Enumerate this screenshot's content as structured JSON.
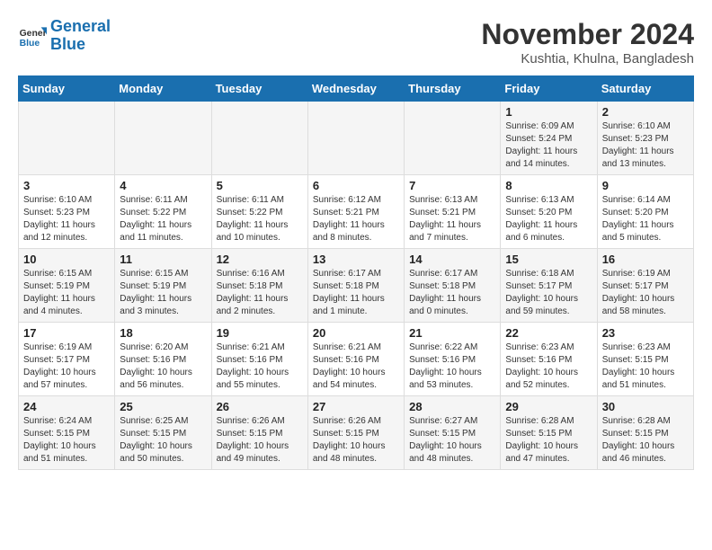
{
  "logo": {
    "line1": "General",
    "line2": "Blue"
  },
  "title": "November 2024",
  "location": "Kushtia, Khulna, Bangladesh",
  "weekdays": [
    "Sunday",
    "Monday",
    "Tuesday",
    "Wednesday",
    "Thursday",
    "Friday",
    "Saturday"
  ],
  "weeks": [
    [
      {
        "day": "",
        "info": ""
      },
      {
        "day": "",
        "info": ""
      },
      {
        "day": "",
        "info": ""
      },
      {
        "day": "",
        "info": ""
      },
      {
        "day": "",
        "info": ""
      },
      {
        "day": "1",
        "info": "Sunrise: 6:09 AM\nSunset: 5:24 PM\nDaylight: 11 hours and 14 minutes."
      },
      {
        "day": "2",
        "info": "Sunrise: 6:10 AM\nSunset: 5:23 PM\nDaylight: 11 hours and 13 minutes."
      }
    ],
    [
      {
        "day": "3",
        "info": "Sunrise: 6:10 AM\nSunset: 5:23 PM\nDaylight: 11 hours and 12 minutes."
      },
      {
        "day": "4",
        "info": "Sunrise: 6:11 AM\nSunset: 5:22 PM\nDaylight: 11 hours and 11 minutes."
      },
      {
        "day": "5",
        "info": "Sunrise: 6:11 AM\nSunset: 5:22 PM\nDaylight: 11 hours and 10 minutes."
      },
      {
        "day": "6",
        "info": "Sunrise: 6:12 AM\nSunset: 5:21 PM\nDaylight: 11 hours and 8 minutes."
      },
      {
        "day": "7",
        "info": "Sunrise: 6:13 AM\nSunset: 5:21 PM\nDaylight: 11 hours and 7 minutes."
      },
      {
        "day": "8",
        "info": "Sunrise: 6:13 AM\nSunset: 5:20 PM\nDaylight: 11 hours and 6 minutes."
      },
      {
        "day": "9",
        "info": "Sunrise: 6:14 AM\nSunset: 5:20 PM\nDaylight: 11 hours and 5 minutes."
      }
    ],
    [
      {
        "day": "10",
        "info": "Sunrise: 6:15 AM\nSunset: 5:19 PM\nDaylight: 11 hours and 4 minutes."
      },
      {
        "day": "11",
        "info": "Sunrise: 6:15 AM\nSunset: 5:19 PM\nDaylight: 11 hours and 3 minutes."
      },
      {
        "day": "12",
        "info": "Sunrise: 6:16 AM\nSunset: 5:18 PM\nDaylight: 11 hours and 2 minutes."
      },
      {
        "day": "13",
        "info": "Sunrise: 6:17 AM\nSunset: 5:18 PM\nDaylight: 11 hours and 1 minute."
      },
      {
        "day": "14",
        "info": "Sunrise: 6:17 AM\nSunset: 5:18 PM\nDaylight: 11 hours and 0 minutes."
      },
      {
        "day": "15",
        "info": "Sunrise: 6:18 AM\nSunset: 5:17 PM\nDaylight: 10 hours and 59 minutes."
      },
      {
        "day": "16",
        "info": "Sunrise: 6:19 AM\nSunset: 5:17 PM\nDaylight: 10 hours and 58 minutes."
      }
    ],
    [
      {
        "day": "17",
        "info": "Sunrise: 6:19 AM\nSunset: 5:17 PM\nDaylight: 10 hours and 57 minutes."
      },
      {
        "day": "18",
        "info": "Sunrise: 6:20 AM\nSunset: 5:16 PM\nDaylight: 10 hours and 56 minutes."
      },
      {
        "day": "19",
        "info": "Sunrise: 6:21 AM\nSunset: 5:16 PM\nDaylight: 10 hours and 55 minutes."
      },
      {
        "day": "20",
        "info": "Sunrise: 6:21 AM\nSunset: 5:16 PM\nDaylight: 10 hours and 54 minutes."
      },
      {
        "day": "21",
        "info": "Sunrise: 6:22 AM\nSunset: 5:16 PM\nDaylight: 10 hours and 53 minutes."
      },
      {
        "day": "22",
        "info": "Sunrise: 6:23 AM\nSunset: 5:16 PM\nDaylight: 10 hours and 52 minutes."
      },
      {
        "day": "23",
        "info": "Sunrise: 6:23 AM\nSunset: 5:15 PM\nDaylight: 10 hours and 51 minutes."
      }
    ],
    [
      {
        "day": "24",
        "info": "Sunrise: 6:24 AM\nSunset: 5:15 PM\nDaylight: 10 hours and 51 minutes."
      },
      {
        "day": "25",
        "info": "Sunrise: 6:25 AM\nSunset: 5:15 PM\nDaylight: 10 hours and 50 minutes."
      },
      {
        "day": "26",
        "info": "Sunrise: 6:26 AM\nSunset: 5:15 PM\nDaylight: 10 hours and 49 minutes."
      },
      {
        "day": "27",
        "info": "Sunrise: 6:26 AM\nSunset: 5:15 PM\nDaylight: 10 hours and 48 minutes."
      },
      {
        "day": "28",
        "info": "Sunrise: 6:27 AM\nSunset: 5:15 PM\nDaylight: 10 hours and 48 minutes."
      },
      {
        "day": "29",
        "info": "Sunrise: 6:28 AM\nSunset: 5:15 PM\nDaylight: 10 hours and 47 minutes."
      },
      {
        "day": "30",
        "info": "Sunrise: 6:28 AM\nSunset: 5:15 PM\nDaylight: 10 hours and 46 minutes."
      }
    ]
  ]
}
